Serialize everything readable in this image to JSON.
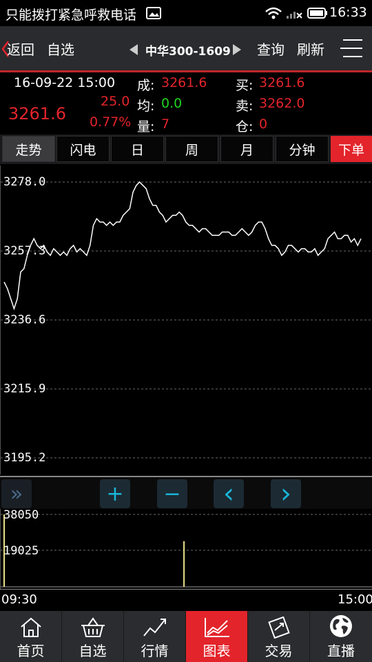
{
  "status_bar": {
    "notice": "只能拨打紧急呼救电话",
    "time": "16:33"
  },
  "nav": {
    "back_label": "返回",
    "favorites_label": "自选",
    "contract": "中华300-1609",
    "query_label": "查询",
    "refresh_label": "刷新"
  },
  "quote": {
    "datetime": "16-09-22 15:00",
    "last_price": "3261.6",
    "change": "25.0",
    "change_pct": "0.77%",
    "deal_label": "成:",
    "deal_value": "3261.6",
    "avg_label": "均:",
    "avg_value": "0.0",
    "vol_label": "量:",
    "vol_value": "7",
    "bid_label": "买:",
    "bid_value": "3261.6",
    "ask_label": "卖:",
    "ask_value": "3262.0",
    "pos_label": "仓:",
    "pos_value": "0"
  },
  "tabs": [
    "走势",
    "闪电",
    "日",
    "周",
    "月",
    "分钟"
  ],
  "order_label": "下单",
  "controls": {
    "expand": "»",
    "zoom_in": "+",
    "zoom_out": "−",
    "prev": "‹",
    "next": "›"
  },
  "chart_data": {
    "type": "line",
    "price_ticks": [
      "3278.0",
      "3257.3",
      "3236.6",
      "3215.9",
      "3195.2"
    ],
    "y_range": [
      3195.2,
      3278.0
    ],
    "x_labels": [
      "09:30",
      "15:00"
    ],
    "price_series": [
      3248,
      3246,
      3243,
      3240,
      3243,
      3251,
      3252,
      3256,
      3259,
      3261,
      3259,
      3258,
      3259,
      3257,
      3256,
      3258,
      3257,
      3256,
      3257,
      3256,
      3258,
      3259,
      3257,
      3258,
      3257,
      3256,
      3259,
      3265,
      3267,
      3266,
      3266,
      3265,
      3266,
      3265,
      3266,
      3266,
      3268,
      3269,
      3270,
      3275,
      3277,
      3278,
      3277,
      3276,
      3273,
      3271,
      3271,
      3269,
      3268,
      3266,
      3267,
      3268,
      3268,
      3269,
      3268,
      3266,
      3265,
      3265,
      3264,
      3263,
      3264,
      3264,
      3263,
      3262,
      3262,
      3262,
      3263,
      3263,
      3263,
      3262,
      3262,
      3263,
      3264,
      3263,
      3262,
      3263,
      3265,
      3266,
      3266,
      3264,
      3261,
      3259,
      3259,
      3258,
      3256,
      3257,
      3259,
      3259,
      3258,
      3257,
      3258,
      3258,
      3257,
      3257,
      3258,
      3256,
      3257,
      3258,
      3261,
      3262,
      3263,
      3261,
      3261,
      3262,
      3262,
      3260,
      3261,
      3259,
      3261
    ],
    "volume_ticks": [
      "38050",
      "19025"
    ],
    "volume_range": [
      0,
      38050
    ],
    "volume_spikes": [
      {
        "t": 0.0,
        "v": 38050
      },
      {
        "t": 0.504,
        "v": 24000
      }
    ]
  },
  "bottom_nav": [
    "首页",
    "自选",
    "行情",
    "图表",
    "交易",
    "直播"
  ],
  "colors": {
    "up": "#e3242b",
    "down": "#1fd41f",
    "active_tab": "#e3242b",
    "accent": "#19b6d8"
  }
}
